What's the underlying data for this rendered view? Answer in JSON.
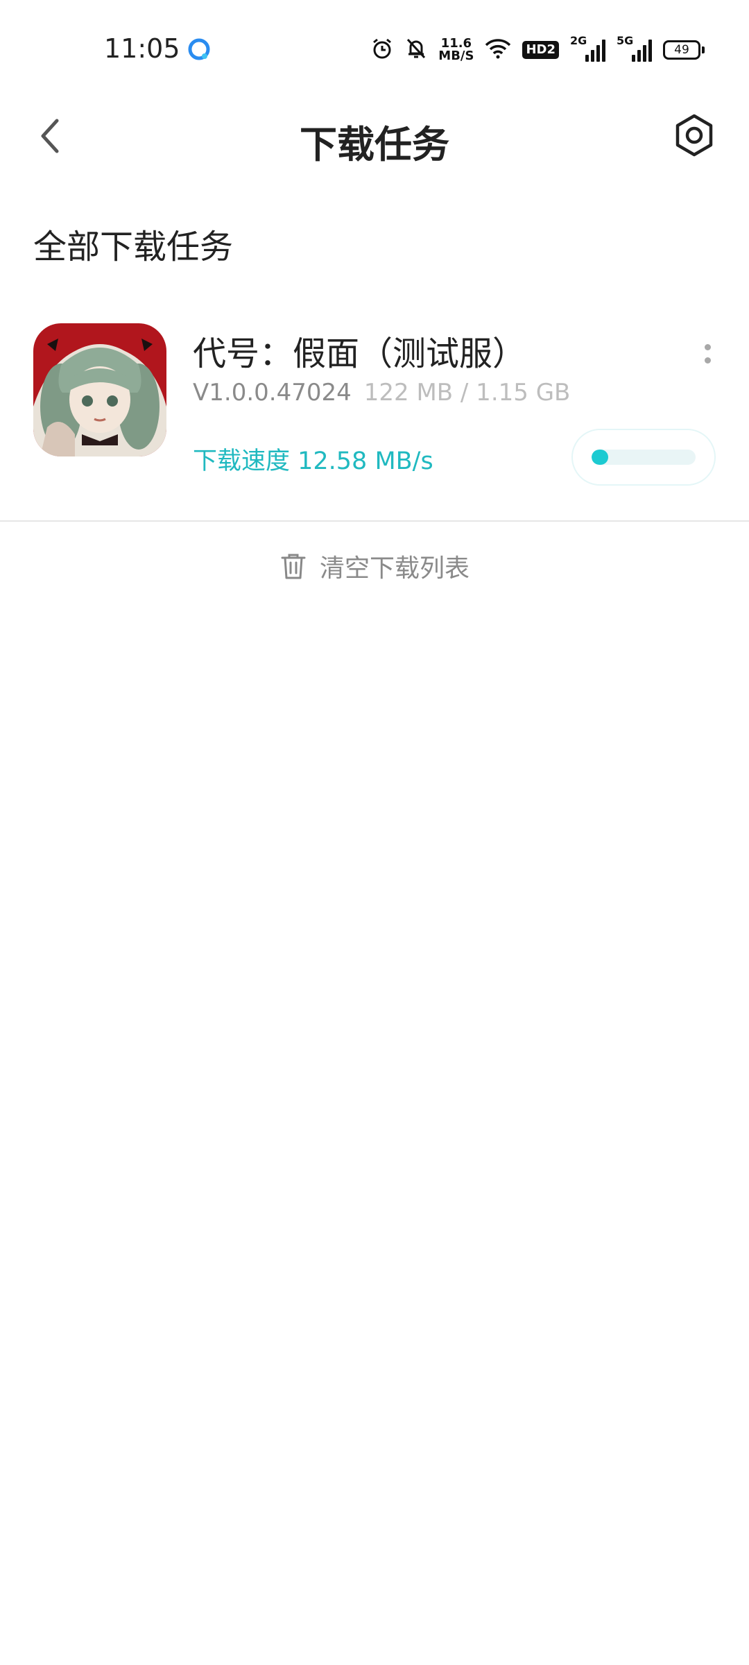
{
  "status_bar": {
    "time": "11:05",
    "net_speed_value": "11.6",
    "net_speed_unit": "MB/S",
    "hd_label": "HD2",
    "sim1_gen": "2G",
    "sim2_gen": "5G",
    "battery": "49"
  },
  "header": {
    "title": "下载任务"
  },
  "section": {
    "title": "全部下载任务"
  },
  "tasks": [
    {
      "name": "代号：假面（测试服）",
      "version": "V1.0.0.47024",
      "size": "122 MB / 1.15 GB",
      "speed": "下载速度 12.58 MB/s",
      "progress_fraction": 0.106
    }
  ],
  "clear_button": {
    "label": "清空下载列表"
  },
  "colors": {
    "accent": "#20b9c0",
    "progress": "#1ccad1"
  }
}
